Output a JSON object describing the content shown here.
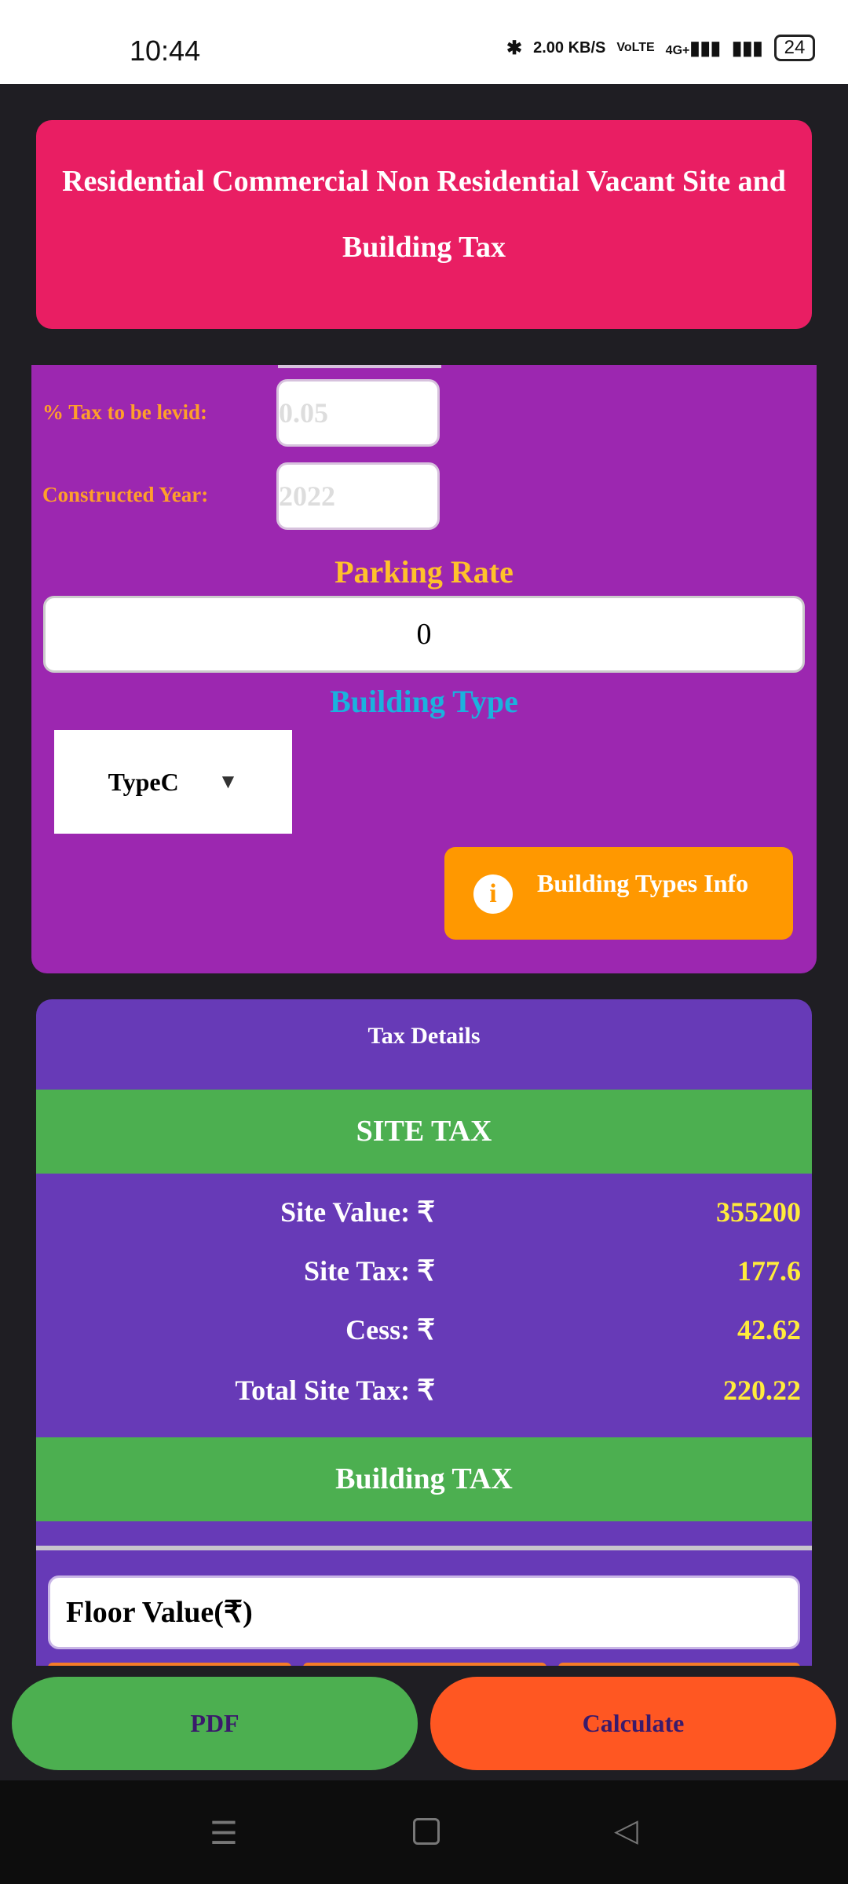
{
  "status_bar": {
    "time": "10:44",
    "net_speed": "2.00 KB/S",
    "volte": "VoLTE",
    "network": "4G+",
    "battery": "24"
  },
  "header": {
    "title": "Residential Commercial Non Residential Vacant Site and Building Tax"
  },
  "form": {
    "tax_label": "% Tax to be levid:",
    "tax_placeholder": "0.05",
    "year_label": "Constructed Year:",
    "year_placeholder": "2022",
    "parking_title": "Parking Rate",
    "parking_value": "0",
    "building_type_title": "Building Type",
    "building_type_selected": "TypeC",
    "info_button": "Building Types Info"
  },
  "tax_details": {
    "title": "Tax Details",
    "site_header": "SITE TAX",
    "rows": [
      {
        "label": "Site Value: ₹",
        "value": "355200"
      },
      {
        "label": "Site Tax: ₹",
        "value": "177.6"
      },
      {
        "label": "Cess: ₹",
        "value": "42.62"
      },
      {
        "label": "Total Site Tax: ₹",
        "value": "220.22"
      }
    ],
    "building_header": "Building TAX",
    "floor_placeholder": "Floor Value(₹)"
  },
  "actions": {
    "pdf": "PDF",
    "calculate": "Calculate"
  },
  "colors": {
    "header": "#e91e63",
    "panel": "#9c27b0",
    "card": "#673ab7",
    "section": "#4caf50",
    "pdf": "#4caf50",
    "calculate": "#ff5722",
    "info": "#ff9800"
  }
}
